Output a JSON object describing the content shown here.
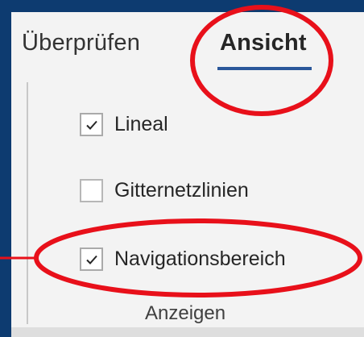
{
  "ribbon": {
    "tabs": [
      {
        "label": "Überprüfen",
        "active": false
      },
      {
        "label": "Ansicht",
        "active": true
      }
    ],
    "accent_color": "#2b579a",
    "group": {
      "label": "Anzeigen",
      "options": [
        {
          "label": "Lineal",
          "checked": true
        },
        {
          "label": "Gitternetzlinien",
          "checked": false
        },
        {
          "label": "Navigationsbereich",
          "checked": true
        }
      ]
    }
  },
  "annotation": {
    "color": "#e8101a",
    "highlighted": [
      "Ansicht",
      "Navigationsbereich"
    ]
  }
}
